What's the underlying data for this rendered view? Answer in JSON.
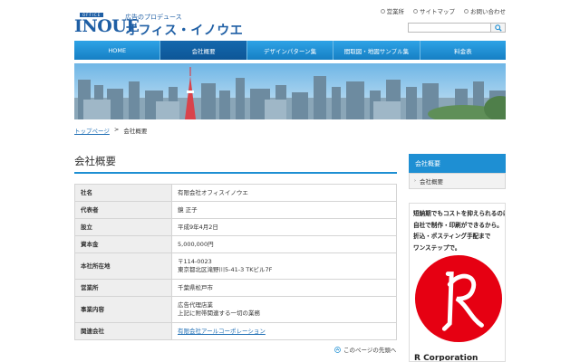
{
  "header": {
    "logo_office": "OFFICE",
    "logo_inoue": "INOUE",
    "tagline": "広告のプロデュース",
    "company": "オフィス・イノウエ",
    "util_links": [
      "営業所",
      "サイトマップ",
      "お問い合わせ"
    ],
    "search_placeholder": ""
  },
  "nav": [
    "HOME",
    "会社概要",
    "デザインパターン集",
    "間取図・地図サンプル集",
    "料金表"
  ],
  "breadcrumb": {
    "home": "トップページ",
    "sep": ">",
    "current": "会社概要"
  },
  "main": {
    "title": "会社概要",
    "rows": [
      {
        "label": "社名",
        "value": "有限会社オフィスイノウエ"
      },
      {
        "label": "代表者",
        "value": "鏡 正子"
      },
      {
        "label": "設立",
        "value": "平成9年4月2日"
      },
      {
        "label": "資本金",
        "value": "5,000,000円"
      },
      {
        "label": "本社所在地",
        "line1": "〒114-0023",
        "line2": "東京都北区滝野川5-41-3 TKビル7F"
      },
      {
        "label": "営業所",
        "value": "千葉県松戸市"
      },
      {
        "label": "事業内容",
        "line1": "広告代理店業",
        "line2": "上記に附帯関連する一切の業務"
      },
      {
        "label": "関連会社",
        "value": "有限会社アールコーポレーション"
      }
    ],
    "to_top": "このページの先頭へ"
  },
  "sidebar": {
    "heading": "会社概要",
    "item": "会社概要",
    "promo_lines": [
      "短納期でもコストを抑えられるのは",
      "自社で制作・印刷ができるから。",
      "折込・ポスティング手配まで",
      "ワンステップで。"
    ],
    "promo_caption": "R Corporation"
  },
  "colors": {
    "accent": "#1e8fd3",
    "nav_active": "#0d5697",
    "logo": "#1f5fa5",
    "promo_red": "#e60012"
  }
}
